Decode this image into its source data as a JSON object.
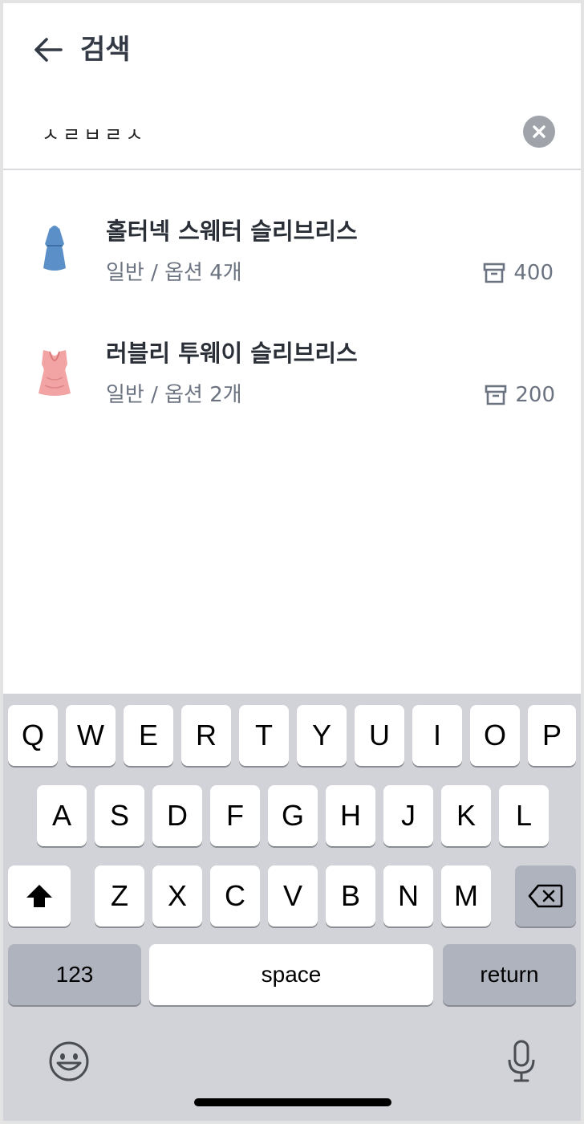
{
  "header": {
    "title": "검색"
  },
  "search": {
    "value": "ㅅㄹㅂㄹㅅ"
  },
  "results": [
    {
      "name": "홀터넥 스웨터 슬리브리스",
      "meta": "일반 / 옵션 4개",
      "stock": "400"
    },
    {
      "name": "러블리 투웨이 슬리브리스",
      "meta": "일반 / 옵션 2개",
      "stock": "200"
    }
  ],
  "keyboard": {
    "row1": [
      "Q",
      "W",
      "E",
      "R",
      "T",
      "Y",
      "U",
      "I",
      "O",
      "P"
    ],
    "row2": [
      "A",
      "S",
      "D",
      "F",
      "G",
      "H",
      "J",
      "K",
      "L"
    ],
    "row3": [
      "Z",
      "X",
      "C",
      "V",
      "B",
      "N",
      "M"
    ],
    "numbers_label": "123",
    "space_label": "space",
    "return_label": "return"
  }
}
